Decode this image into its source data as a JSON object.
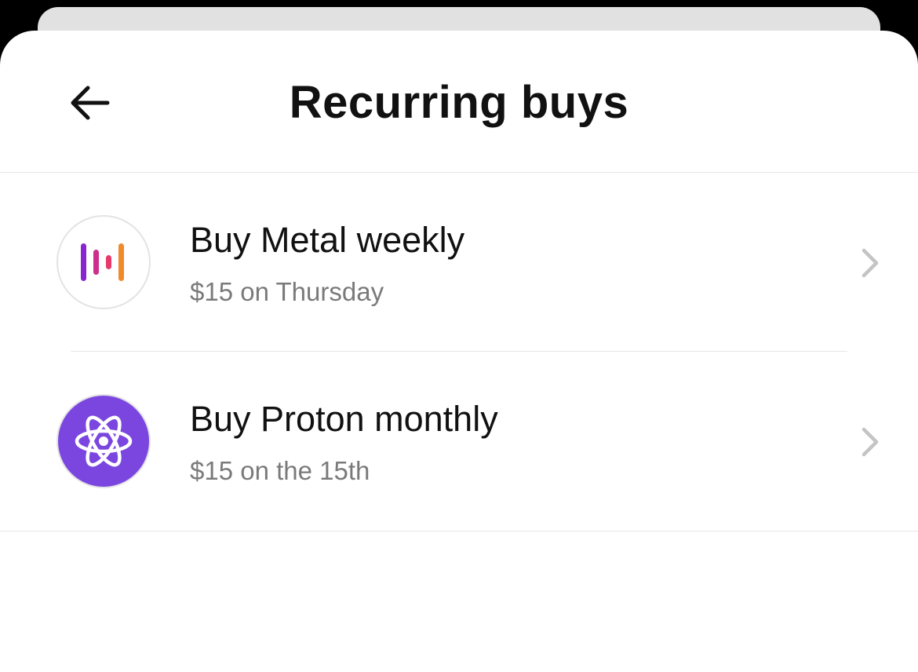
{
  "header": {
    "title": "Recurring buys",
    "back_icon": "arrow-left-icon"
  },
  "recurring_buys": [
    {
      "title": "Buy Metal weekly",
      "subtitle": "$15 on Thursday",
      "icon": "metal-logo-icon"
    },
    {
      "title": "Buy Proton monthly",
      "subtitle": "$15 on the 15th",
      "icon": "proton-atom-icon",
      "icon_bg": "#7b46e0"
    }
  ],
  "colors": {
    "text_primary": "#111111",
    "text_secondary": "#7a7a7a",
    "divider": "#e6e6e6",
    "chevron": "#c4c4c4"
  }
}
